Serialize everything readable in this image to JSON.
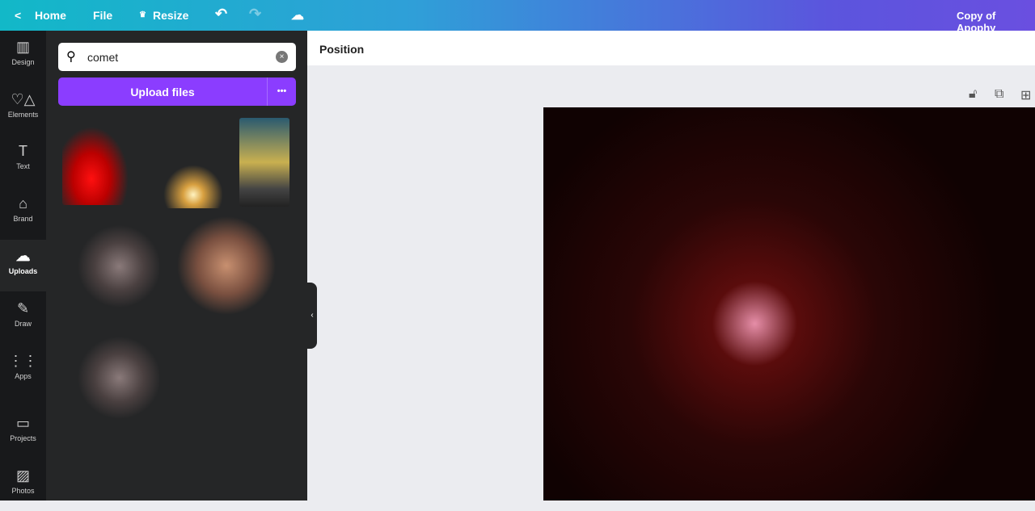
{
  "topbar": {
    "home": "Home",
    "file": "File",
    "resize": "Resize",
    "doc_title": "Copy of Apophy"
  },
  "rail": [
    {
      "label": "Design",
      "icon": "▥"
    },
    {
      "label": "Elements",
      "icon": "♡△"
    },
    {
      "label": "Text",
      "icon": "T"
    },
    {
      "label": "Brand",
      "icon": "⌂"
    },
    {
      "label": "Uploads",
      "icon": "☁"
    },
    {
      "label": "Draw",
      "icon": "✎"
    },
    {
      "label": "Apps",
      "icon": "⋮⋮"
    },
    {
      "label": "Projects",
      "icon": "▭"
    },
    {
      "label": "Photos",
      "icon": "▨"
    }
  ],
  "search": {
    "value": "comet"
  },
  "upload": {
    "label": "Upload files",
    "more": "•••"
  },
  "toolbar": {
    "position": "Position"
  }
}
